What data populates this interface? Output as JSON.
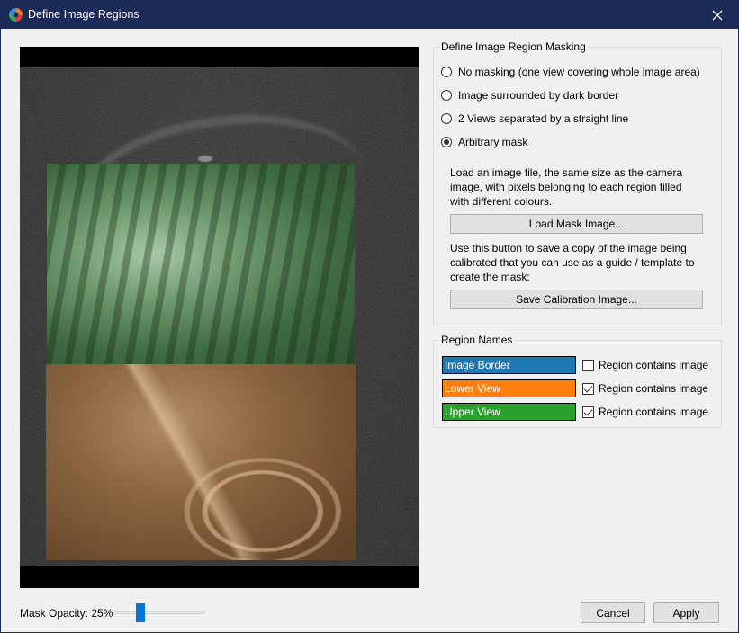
{
  "window": {
    "title": "Define Image Regions",
    "icon": "app-logo-icon",
    "close_icon": "close-icon"
  },
  "masking": {
    "group_title": "Define Image Region Masking",
    "options": [
      {
        "label": "No masking (one view covering whole image area)",
        "checked": false
      },
      {
        "label": "Image surrounded by dark border",
        "checked": false
      },
      {
        "label": "2 Views separated by a straight line",
        "checked": false
      },
      {
        "label": "Arbitrary mask",
        "checked": true
      }
    ],
    "load_description": "Load an image file, the same size as the camera image, with pixels belonging to each region filled with different colours.",
    "load_button": "Load Mask Image...",
    "save_description": "Use this button to save a copy of the image being calibrated that you can use as a guide / template to create the mask:",
    "save_button": "Save Calibration Image..."
  },
  "region_names": {
    "group_title": "Region Names",
    "regions": [
      {
        "name": "Image Border",
        "color": "#1f77b4",
        "contains_image_label": "Region contains image",
        "contains_image": false
      },
      {
        "name": "Lower View",
        "color": "#ff7f0e",
        "contains_image_label": "Region contains image",
        "contains_image": true
      },
      {
        "name": "Upper View",
        "color": "#2ca02c",
        "contains_image_label": "Region contains image",
        "contains_image": true
      }
    ]
  },
  "footer": {
    "opacity_label": "Mask Opacity: 25%",
    "opacity_value": 25,
    "cancel_button": "Cancel",
    "apply_button": "Apply"
  },
  "colors": {
    "titlebar": "#1c2a57",
    "slider_accent": "#0078d7"
  }
}
